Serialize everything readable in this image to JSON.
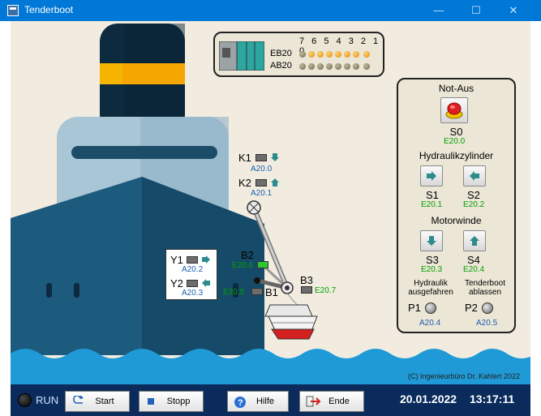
{
  "window": {
    "title": "Tenderboot",
    "min": "—",
    "max": "☐",
    "close": "✕"
  },
  "plc": {
    "bit_numbers": "7 6 5 4 3 2 1 0",
    "input_row": "EB20",
    "output_row": "AB20"
  },
  "diagram": {
    "k1": {
      "label": "K1",
      "address": "A20.0"
    },
    "k2": {
      "label": "K2",
      "address": "A20.1"
    },
    "y1": {
      "label": "Y1",
      "address": "A20.2"
    },
    "y2": {
      "label": "Y2",
      "address": "A20.3"
    },
    "b1": {
      "label": "B1",
      "address": "E20.5"
    },
    "b2": {
      "label": "B2",
      "address": "E20.6"
    },
    "b3": {
      "label": "B3",
      "address": "E20.7"
    }
  },
  "panel": {
    "emergency": {
      "title": "Not-Aus",
      "label": "S0",
      "address": "E20.0"
    },
    "hydraulics": {
      "title": "Hydraulikzylinder",
      "s1": "S1",
      "s1_addr": "E20.1",
      "s2": "S2",
      "s2_addr": "E20.2"
    },
    "winch": {
      "title": "Motorwinde",
      "s3": "S3",
      "s3_addr": "E20.3",
      "s4": "S4",
      "s4_addr": "E20.4"
    },
    "p1": {
      "line1": "Hydraulik",
      "line2": "ausgefahren",
      "label": "P1",
      "address": "A20.4"
    },
    "p2": {
      "line1": "Tenderboot",
      "line2": "ablassen",
      "label": "P2",
      "address": "A20.5"
    }
  },
  "copyright": "(C) Ingenieurbüro Dr. Kahlert 2022",
  "statusbar": {
    "run": "RUN",
    "start": "Start",
    "stop": "Stopp",
    "help": "Hilfe",
    "exit": "Ende",
    "date": "20.01.2022",
    "time": "13:17:11"
  }
}
